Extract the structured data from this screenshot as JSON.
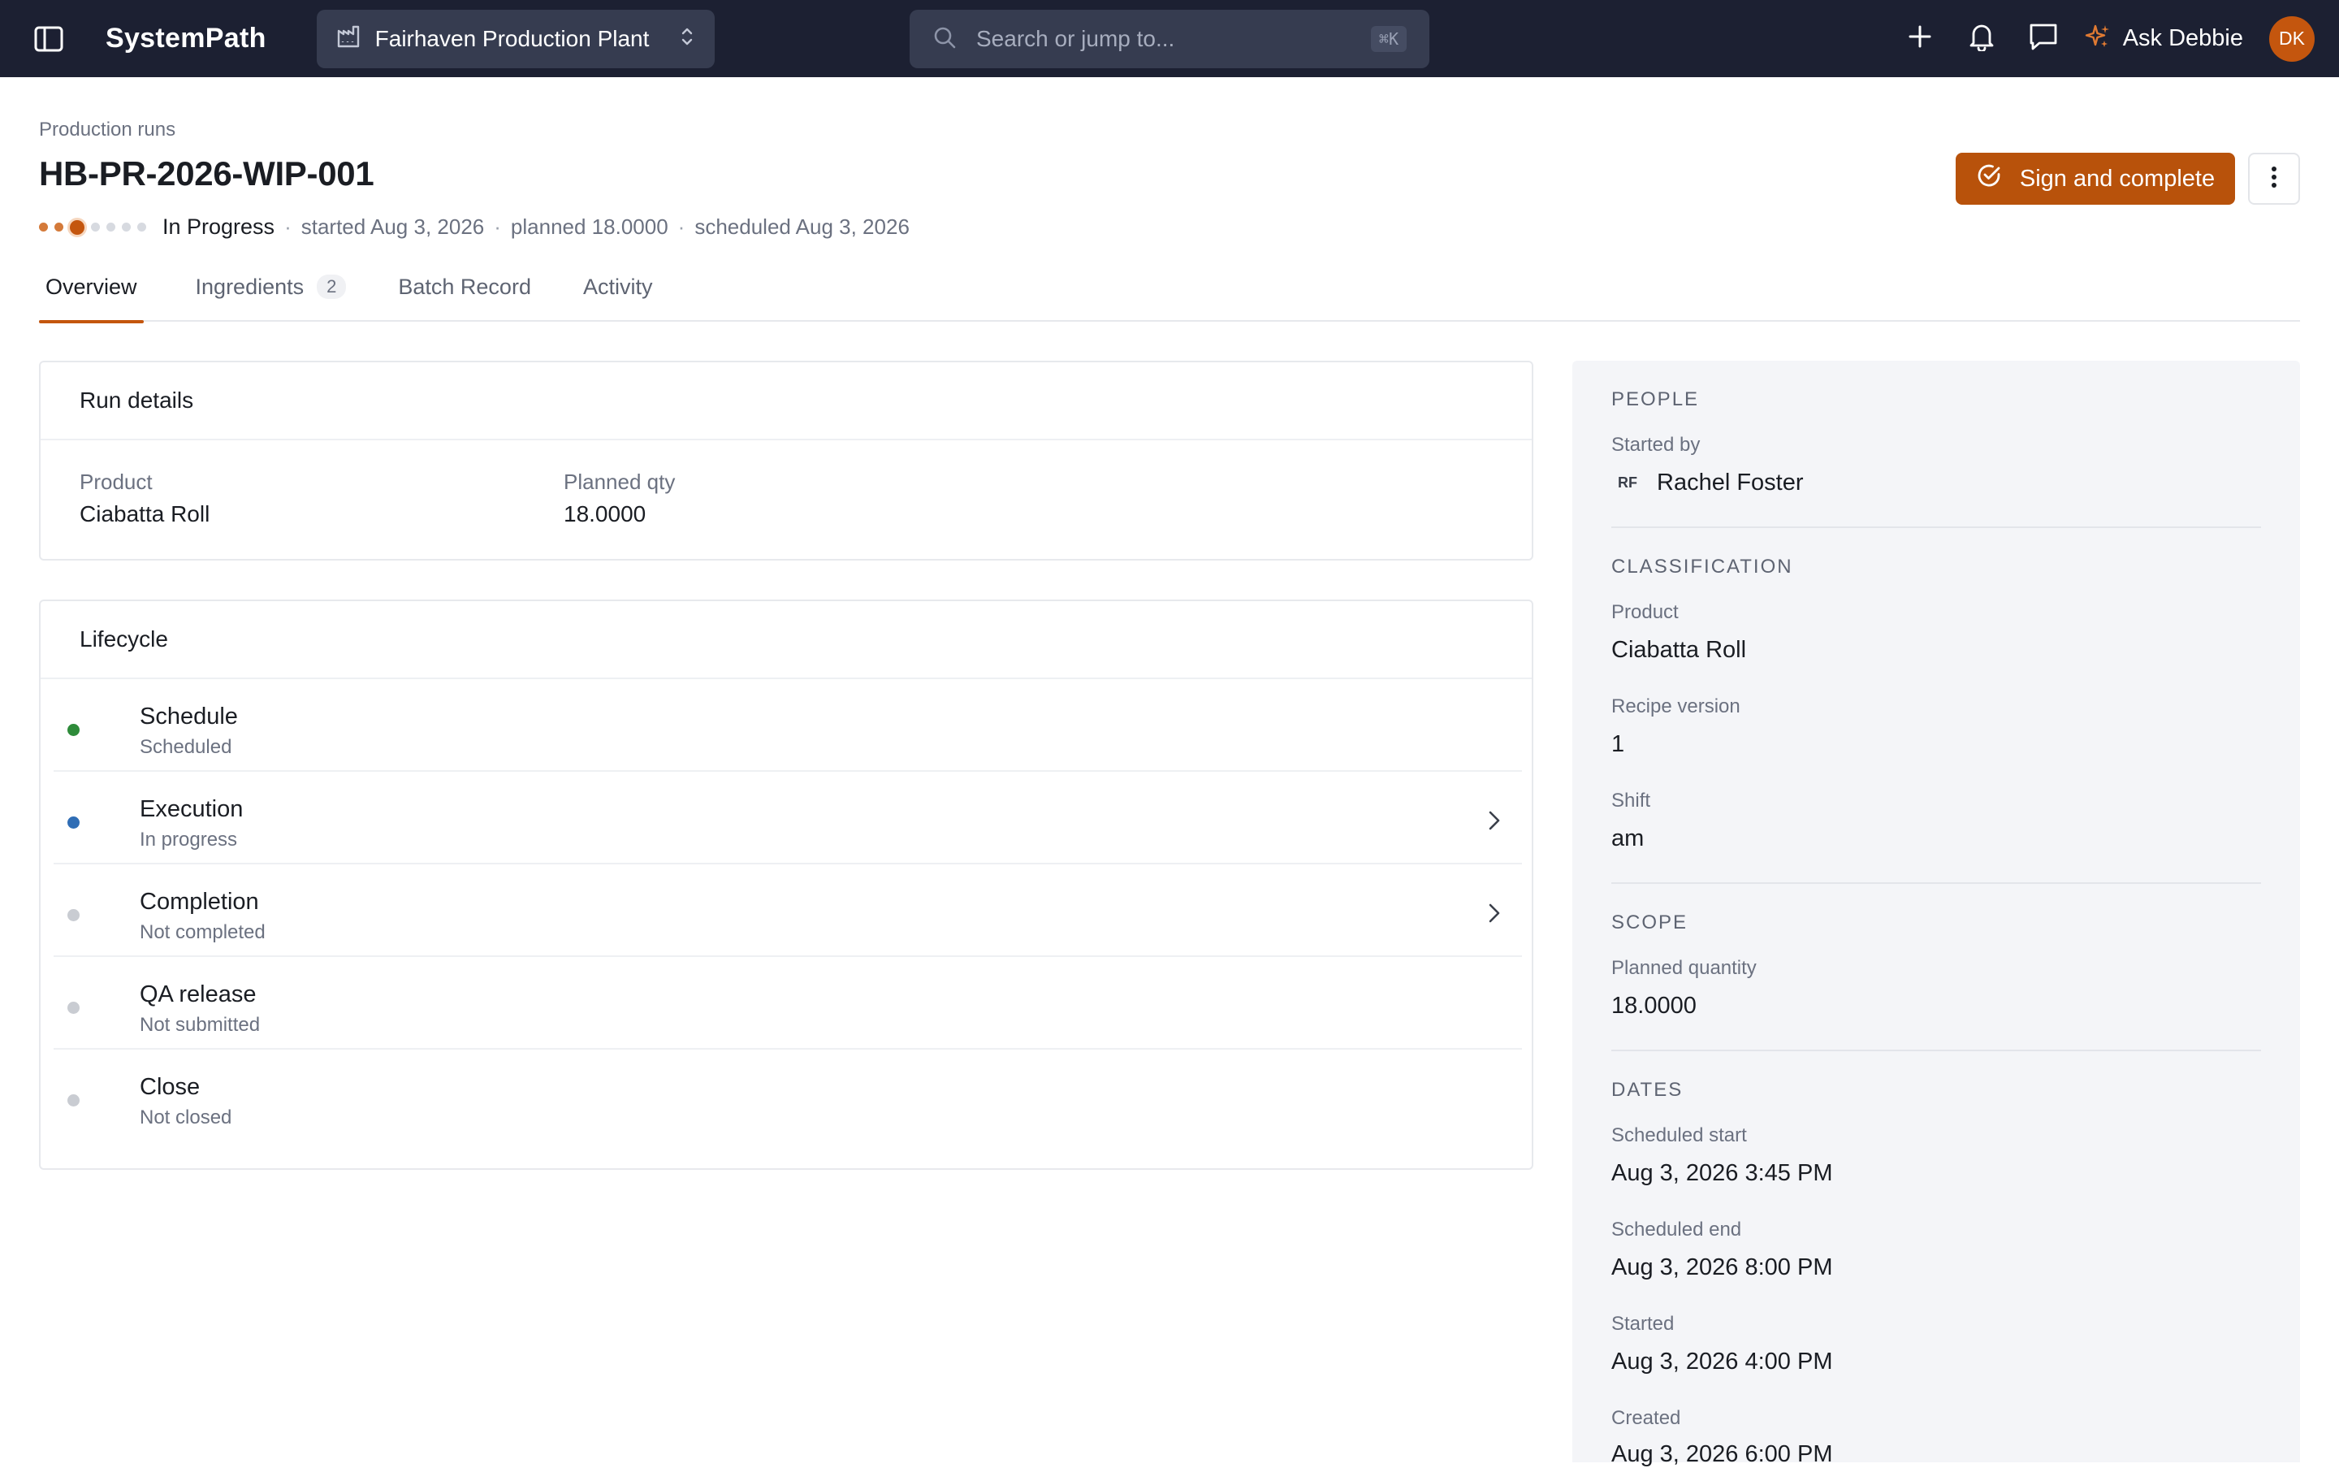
{
  "topbar": {
    "brand": "SystemPath",
    "plant": "Fairhaven Production Plant",
    "search_placeholder": "Search or jump to...",
    "search_shortcut": "⌘K",
    "ask_label": "Ask Debbie",
    "avatar_initials": "DK"
  },
  "header": {
    "breadcrumb": "Production runs",
    "title": "HB-PR-2026-WIP-001",
    "status": "In Progress",
    "started": "started Aug 3, 2026",
    "planned": "planned 18.0000",
    "scheduled": "scheduled Aug 3, 2026",
    "sign_button": "Sign and complete",
    "progress": {
      "total_steps": 7,
      "completed_steps": 2,
      "current_step": 3
    }
  },
  "tabs": [
    {
      "label": "Overview",
      "active": true
    },
    {
      "label": "Ingredients",
      "count": "2"
    },
    {
      "label": "Batch Record"
    },
    {
      "label": "Activity"
    }
  ],
  "run_details": {
    "title": "Run details",
    "product_label": "Product",
    "product_value": "Ciabatta Roll",
    "qty_label": "Planned qty",
    "qty_value": "18.0000"
  },
  "lifecycle": {
    "title": "Lifecycle",
    "steps": [
      {
        "name": "Schedule",
        "status": "Scheduled",
        "color": "#2e8b3a"
      },
      {
        "name": "Execution",
        "status": "In progress",
        "color": "#2f6db5"
      },
      {
        "name": "Completion",
        "status": "Not completed",
        "color": "#c9ccd2"
      },
      {
        "name": "QA release",
        "status": "Not submitted",
        "color": "#c9ccd2"
      },
      {
        "name": "Close",
        "status": "Not closed",
        "color": "#c9ccd2"
      }
    ]
  },
  "side": {
    "people_title": "PEOPLE",
    "started_by_label": "Started by",
    "started_by_initials": "RF",
    "started_by_name": "Rachel Foster",
    "classification_title": "CLASSIFICATION",
    "product_label": "Product",
    "product_value": "Ciabatta Roll",
    "recipe_label": "Recipe version",
    "recipe_value": "1",
    "shift_label": "Shift",
    "shift_value": "am",
    "scope_title": "SCOPE",
    "planned_label": "Planned quantity",
    "planned_value": "18.0000",
    "dates_title": "DATES",
    "sched_start_label": "Scheduled start",
    "sched_start_value": "Aug 3, 2026 3:45 PM",
    "sched_end_label": "Scheduled end",
    "sched_end_value": "Aug 3, 2026 8:00 PM",
    "started_label": "Started",
    "started_value": "Aug 3, 2026 4:00 PM",
    "created_label": "Created",
    "created_value": "Aug 3, 2026 6:00 PM"
  },
  "colors": {
    "accent": "#c4560e",
    "topbar": "#1c2032"
  }
}
